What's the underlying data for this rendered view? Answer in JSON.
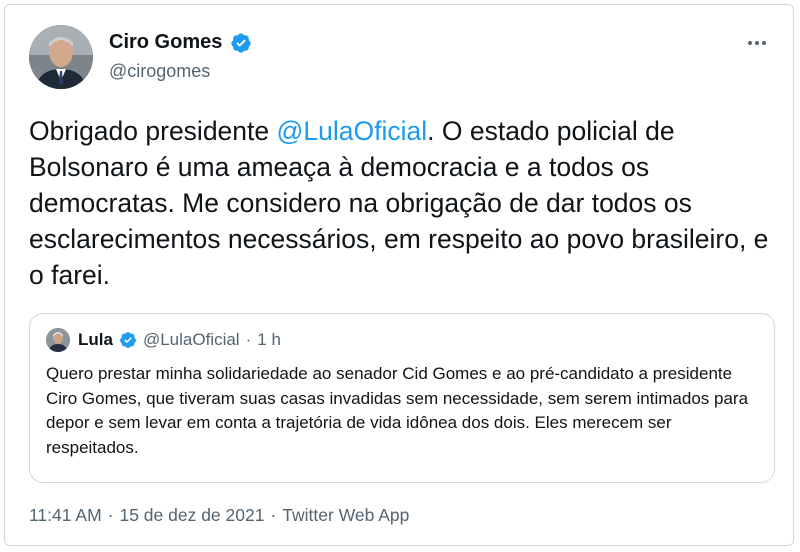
{
  "tweet": {
    "author": {
      "display_name": "Ciro Gomes",
      "handle": "@cirogomes",
      "verified": true
    },
    "text_before_mention": "Obrigado presidente ",
    "mention": "@LulaOficial",
    "text_after_mention": ". O estado policial de Bolsonaro é uma ameaça à democracia e a todos os democratas. Me considero na obrigação de dar todos os esclarecimentos necessários, em respeito ao povo brasileiro, e o farei.",
    "timestamp": "11:41 AM",
    "date": "15 de dez de 2021",
    "separator": "·",
    "source_app": "Twitter Web App"
  },
  "quoted_tweet": {
    "display_name": "Lula",
    "handle": "@LulaOficial",
    "separator": "·",
    "time_ago": "1 h",
    "text": "Quero prestar minha solidariedade ao senador Cid Gomes e ao pré-candidato a presidente Ciro Gomes, que tiveram suas casas invadidas sem necessidade, sem serem intimados para depor e sem levar em conta a trajetória de vida idônea dos dois. Eles merecem ser respeitados."
  },
  "icons": {
    "verified": "verified-badge-icon",
    "more": "more-options-icon"
  },
  "colors": {
    "link": "#1d9bf0",
    "secondary_text": "#536471",
    "border": "#cfd9de"
  }
}
